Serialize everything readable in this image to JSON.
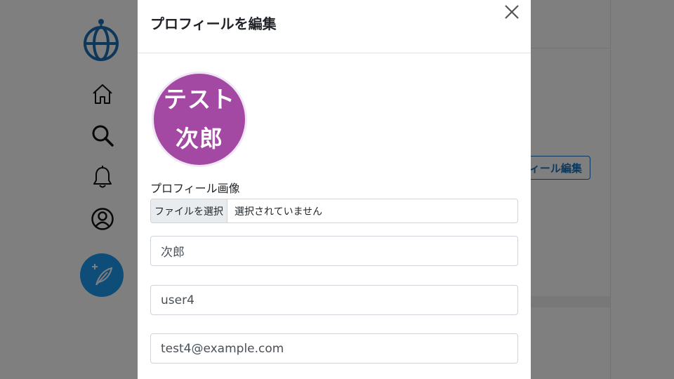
{
  "background": {
    "nav_icons": [
      "globe-logo-icon",
      "home-icon",
      "search-icon",
      "bell-icon",
      "user-circle-icon",
      "feather-compose-icon"
    ],
    "edit_profile_button_partial": "フィール編集"
  },
  "modal": {
    "title": "プロフィールを編集",
    "close_icon": "close-icon",
    "avatar": {
      "line1": "テスト",
      "line2": "次郎",
      "color": "#a349a4"
    },
    "image_label": "プロフィール画像",
    "file_button": "ファイルを選択",
    "file_status": "選択されていません",
    "fields": {
      "name": "次郎",
      "username": "user4",
      "email": "test4@example.com"
    }
  },
  "colors": {
    "accent": "#1d9bf0",
    "logo": "#1d6fb8",
    "overlay": "rgba(0,0,0,0.5)"
  }
}
